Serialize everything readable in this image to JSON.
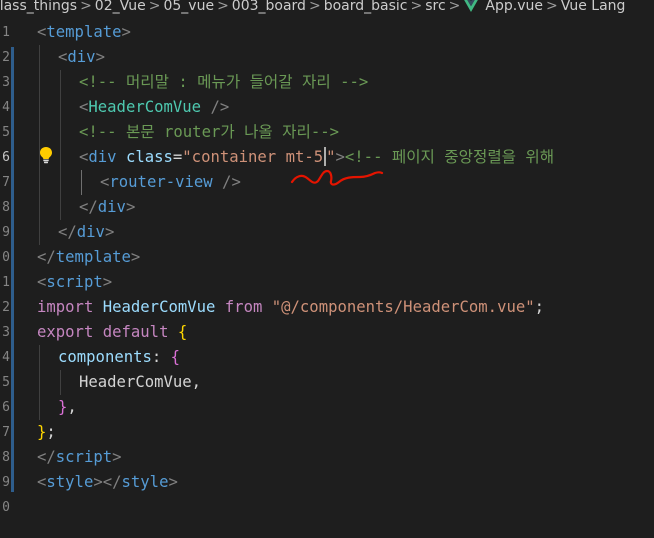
{
  "breadcrumb": {
    "segments": [
      "class_things",
      "02_Vue",
      "05_vue",
      "003_board",
      "board_basic",
      "src"
    ],
    "file": "App.vue",
    "trail": "Vue Lang",
    "separator": ">"
  },
  "editor": {
    "line_numbers": [
      "1",
      "2",
      "3",
      "4",
      "5",
      "6",
      "7",
      "8",
      "9",
      "0",
      "1",
      "2",
      "3",
      "4",
      "5",
      "6",
      "7",
      "8",
      "9",
      "0",
      "1"
    ],
    "active_line_index": 6,
    "lines": {
      "l1": {
        "open": "<",
        "name": "template",
        "close": ">"
      },
      "l2": {
        "open": "<",
        "name": "div",
        "close": ">"
      },
      "l3": {
        "comment": "<!-- 머리말 : 메뉴가 들어갈 자리 -->"
      },
      "l4": {
        "open": "<",
        "name": "HeaderComVue",
        "close": " />"
      },
      "l5": {
        "comment": "<!-- 본문 router가 나올 자리-->"
      },
      "l6": {
        "open": "<",
        "name": "div",
        "attr": "class",
        "eq": "=",
        "value_before_cursor": "\"container mt-5",
        "value_after_cursor": "\"",
        "close": ">",
        "comment": "<!-- 페이지 중앙정렬을 위해"
      },
      "l7": {
        "open": "<",
        "name": "router-view",
        "close": " />"
      },
      "l8": {
        "open": "</",
        "name": "div",
        "close": ">"
      },
      "l9": {
        "open": "</",
        "name": "div",
        "close": ">"
      },
      "l10": {
        "open": "</",
        "name": "template",
        "close": ">"
      },
      "l11": {
        "open": "<",
        "name": "script",
        "close": ">"
      },
      "l12": {
        "kw": "import",
        "ident": "HeaderComVue",
        "from": "from",
        "str": "\"@/components/HeaderCom.vue\"",
        "end": ";"
      },
      "l13": {
        "kw1": "export",
        "kw2": "default",
        "brace": "{"
      },
      "l14": {
        "prop": "components",
        "colon": ":",
        "brace": "{"
      },
      "l15": {
        "ident": "HeaderComVue",
        "comma": ","
      },
      "l16": {
        "brace": "}",
        "comma": ","
      },
      "l17": {
        "brace": "}",
        "semi": ";"
      },
      "l18": {
        "open": "</",
        "name": "script",
        "close": ">"
      },
      "l19": {
        "open": "<",
        "name": "style",
        "mid": "></",
        "name2": "style",
        "close": ">"
      }
    }
  },
  "colors": {
    "background": "#1e1e1e",
    "tag": "#569cd6",
    "bracket": "#808080",
    "comment": "#6a9955",
    "component": "#4ec9b0",
    "attribute": "#9cdcfe",
    "string": "#ce9178",
    "keyword": "#c586c0",
    "brace_gold": "#ffd700",
    "brace_orchid": "#da70d6",
    "annotation": "#e51400"
  },
  "icons": {
    "vue": "vue-logo-icon",
    "lightbulb": "lightbulb-icon",
    "squiggle": "squiggle-annotation"
  }
}
